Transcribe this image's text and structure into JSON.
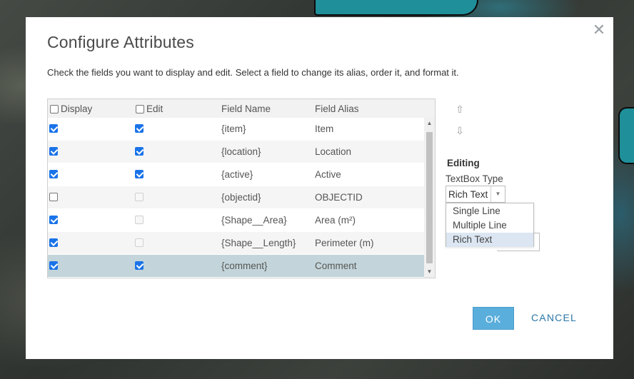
{
  "dialog": {
    "title": "Configure Attributes",
    "description": "Check the fields you want to display and edit. Select a field to change its alias, order it, and format it.",
    "close_glyph": "✕"
  },
  "table": {
    "headers": {
      "display": "Display",
      "edit": "Edit",
      "field_name": "Field Name",
      "field_alias": "Field Alias"
    },
    "rows": [
      {
        "field_name": "{item}",
        "field_alias": "Item",
        "display": true,
        "edit": true,
        "edit_enabled": true
      },
      {
        "field_name": "{location}",
        "field_alias": "Location",
        "display": true,
        "edit": true,
        "edit_enabled": true
      },
      {
        "field_name": "{active}",
        "field_alias": "Active",
        "display": true,
        "edit": true,
        "edit_enabled": true
      },
      {
        "field_name": "{objectid}",
        "field_alias": "OBJECTID",
        "display": false,
        "edit": false,
        "edit_enabled": false
      },
      {
        "field_name": "{Shape__Area}",
        "field_alias": "Area (m²)",
        "display": true,
        "edit": false,
        "edit_enabled": false
      },
      {
        "field_name": "{Shape__Length}",
        "field_alias": "Perimeter (m)",
        "display": true,
        "edit": false,
        "edit_enabled": false
      },
      {
        "field_name": "{comment}",
        "field_alias": "Comment",
        "display": true,
        "edit": true,
        "edit_enabled": true,
        "selected": true
      }
    ]
  },
  "editing": {
    "title": "Editing",
    "textbox_type_label": "TextBox Type",
    "selected_value": "Rich Text",
    "options": [
      "Single Line",
      "Multiple Line",
      "Rich Text"
    ]
  },
  "buttons": {
    "ok": "OK",
    "cancel": "CANCEL"
  },
  "icons": {
    "move_up": "⇧",
    "move_down": "⇩",
    "scroll_up": "▲",
    "scroll_down": "▼",
    "dropdown_arrow": "▼"
  },
  "colors": {
    "selected_row": "#c3d5da",
    "primary_button": "#5aaedc",
    "checkbox_checked": "#1a73e8",
    "cancel_link": "#2b78a8"
  }
}
